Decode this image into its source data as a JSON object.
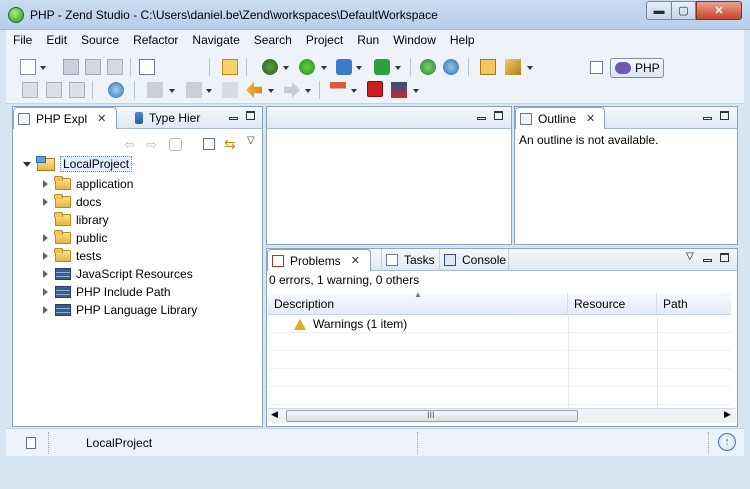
{
  "window": {
    "title": "PHP - Zend Studio - C:\\Users\\daniel.be\\Zend\\workspaces\\DefaultWorkspace",
    "min_glyph": "▬",
    "max_glyph": "▢",
    "close_glyph": "✕"
  },
  "menu": [
    "File",
    "Edit",
    "Source",
    "Refactor",
    "Navigate",
    "Search",
    "Project",
    "Run",
    "Window",
    "Help"
  ],
  "perspective": {
    "label": "PHP"
  },
  "explorer": {
    "tab_php": "PHP Expl",
    "tab_type": "Type Hier",
    "project": "LocalProject",
    "items": [
      {
        "label": "application",
        "kind": "folder",
        "expandable": true
      },
      {
        "label": "docs",
        "kind": "folder",
        "expandable": true
      },
      {
        "label": "library",
        "kind": "folder",
        "expandable": false
      },
      {
        "label": "public",
        "kind": "folder",
        "expandable": true
      },
      {
        "label": "tests",
        "kind": "folder",
        "expandable": true
      },
      {
        "label": "JavaScript Resources",
        "kind": "lib",
        "expandable": true
      },
      {
        "label": "PHP Include Path",
        "kind": "lib",
        "expandable": true
      },
      {
        "label": "PHP Language Library",
        "kind": "lib",
        "expandable": true
      }
    ]
  },
  "outline": {
    "tab": "Outline",
    "message": "An outline is not available."
  },
  "bottom": {
    "tab_problems": "Problems",
    "tab_tasks": "Tasks",
    "tab_console": "Console",
    "summary": "0 errors, 1 warning, 0 others",
    "columns": [
      "Description",
      "Resource",
      "Path"
    ],
    "row_warnings": "Warnings (1 item)",
    "scroll_grip": "III"
  },
  "statusbar": {
    "project": "LocalProject"
  }
}
